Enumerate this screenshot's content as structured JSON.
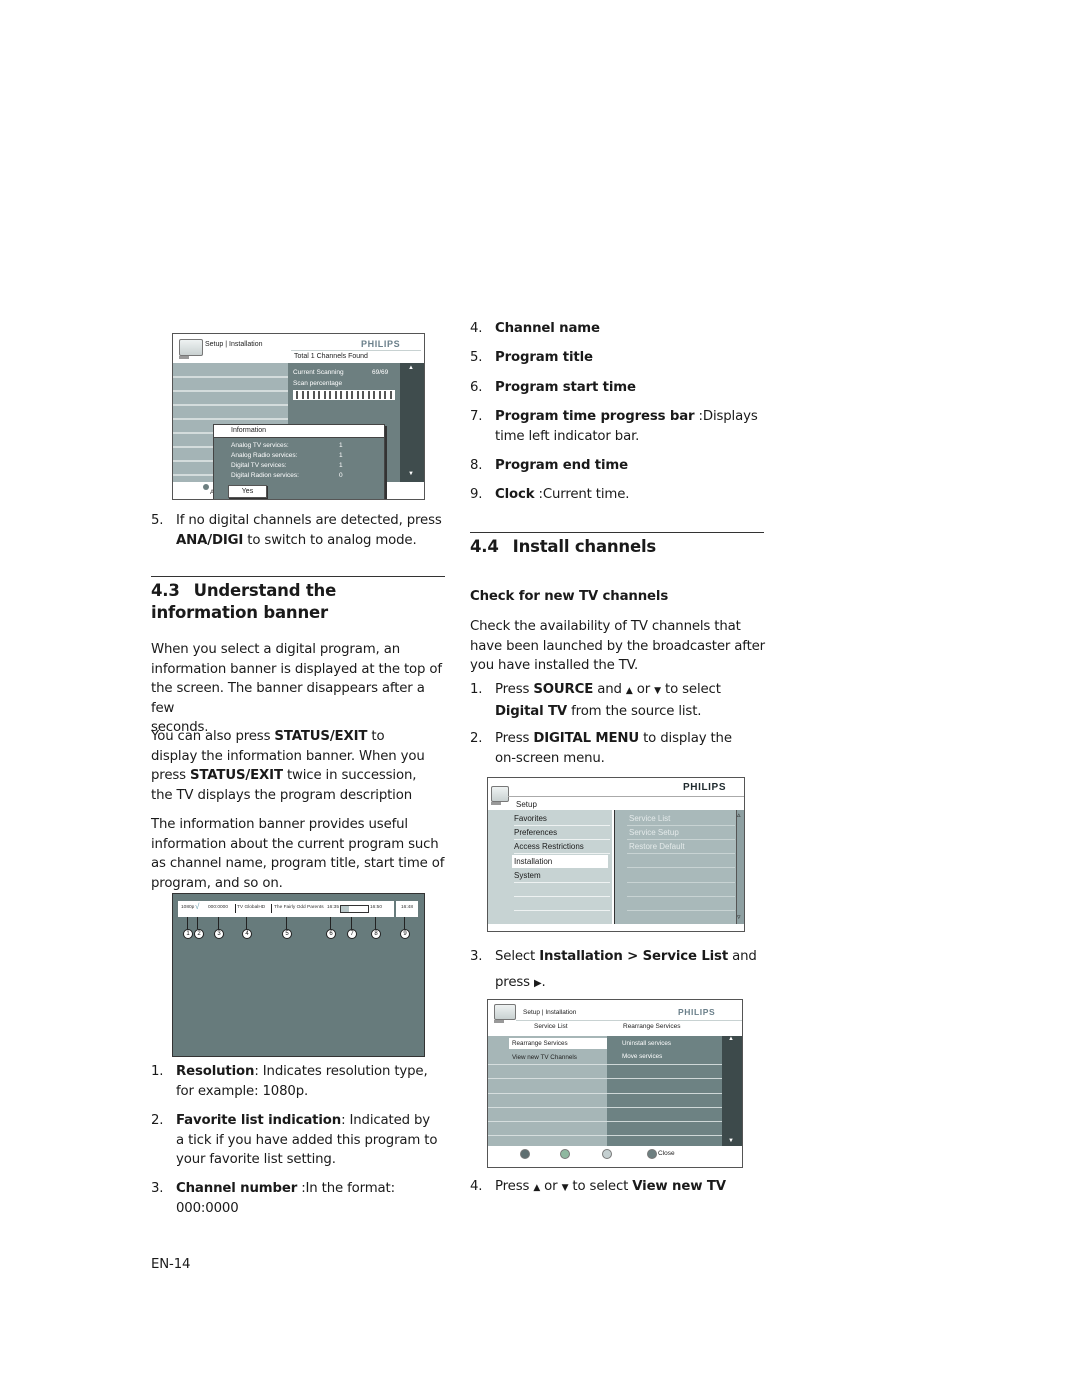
{
  "left_column": {
    "step5": {
      "number": "5.",
      "line1": "If no digital channels are detected, press",
      "bold": "ANA/DIGI",
      "rest": " to switch to analog mode."
    },
    "section_43": {
      "number": "4.3",
      "title_line1": "Understand the",
      "title_line2": "information banner"
    },
    "para1": [
      "When you select a digital program, an",
      "information banner is displayed at the top of",
      "the screen. The banner disappears after a few",
      "seconds."
    ],
    "para2": {
      "l1_pre": "You can also press ",
      "l1_bold": "STATUS/EXIT",
      "l1_post": " to",
      "l2": "display the information banner. When you",
      "l3_pre": "press ",
      "l3_bold": "STATUS/EXIT",
      "l3_post": " twice in succession,",
      "l4": "the TV displays the program description"
    },
    "para3": [
      "The information banner provides useful",
      "information about the current program such",
      "as channel name, program title, start time of",
      "program, and so on."
    ],
    "items": [
      {
        "n": "1.",
        "bold": "Resolution",
        "text": ": Indicates resolution type,",
        "cont": "for example: 1080p."
      },
      {
        "n": "2.",
        "bold": "Favorite list indication",
        "text": ": Indicated by",
        "cont": "a tick if you have added this program to",
        "cont2": "your favorite list setting."
      },
      {
        "n": "3.",
        "bold": "Channel number",
        "text": " :In the format:",
        "cont": "000:0000"
      }
    ],
    "page_number": "EN-14"
  },
  "right_column": {
    "items": [
      {
        "n": "4.",
        "bold": "Channel name"
      },
      {
        "n": "5.",
        "bold": "Program title"
      },
      {
        "n": "6.",
        "bold": "Program start time"
      },
      {
        "n": "7.",
        "bold": "Program time progress bar",
        "text": " :Displays",
        "cont": "time left indicator bar."
      },
      {
        "n": "8.",
        "bold": "Program end time"
      },
      {
        "n": "9.",
        "bold": "Clock",
        "text": " :Current time."
      }
    ],
    "section_44": {
      "number": "4.4",
      "title": "Install channels"
    },
    "subheading": "Check for new TV channels",
    "intro": [
      "Check the availability of TV channels that",
      "have been launched by the broadcaster after",
      "you have installed the TV."
    ],
    "steps": [
      {
        "n": "1.",
        "l1_pre": "Press ",
        "l1_bold": "SOURCE",
        "l1_mid": " and ",
        "up": "▲",
        "or": " or ",
        "down": "▼",
        "l1_post": " to select",
        "l2_bold": "Digital TV",
        "l2_post": " from the source list."
      },
      {
        "n": "2.",
        "l1_pre": "Press ",
        "l1_bold": "DIGITAL MENU",
        "l1_post": " to display the",
        "l2": "on-screen menu."
      },
      {
        "n": "3.",
        "l1_pre": "Select ",
        "l1_bold": "Installation > Service List",
        "l1_post": " and",
        "l2": "press ",
        "arrow": "▶",
        "l2_post": "."
      },
      {
        "n": "4.",
        "l1_pre": "Press ",
        "up": "▲",
        "or": " or ",
        "down": "▼",
        "l1_mid": " to select ",
        "l1_bold": "View new TV"
      }
    ]
  },
  "screen_scan": {
    "breadcrumb_setup": "Setup",
    "breadcrumb_sep": "|",
    "breadcrumb_installation": "Installation",
    "brand": "PHILIPS",
    "total_found": "Total 1 Channels Found",
    "current_scanning_label": "Current Scanning",
    "current_scanning_value": "69/69",
    "scan_percentage_label": "Scan percentage",
    "scan_progress": 1.0,
    "dialog_title": "Information",
    "rows": [
      {
        "label": "Analog TV services:",
        "value": "1"
      },
      {
        "label": "Analog Radio services:",
        "value": "1"
      },
      {
        "label": "Digital TV services:",
        "value": "1"
      },
      {
        "label": "Digital Radion services:",
        "value": "0"
      }
    ],
    "yes_button": "Yes",
    "footer": "A service scan is in progress, please press OK to stop.",
    "scroll_up": "▲",
    "scroll_down": "▼"
  },
  "screen_banner": {
    "resolution": "1080p",
    "tick": "√",
    "channel_number": "000:0000",
    "channel_name": "TV GlobalHD",
    "program_title": "The Fairly Odd Parents",
    "start_time": "16:35",
    "progress": 0.3,
    "end_time": "16:50",
    "clock": "16:48",
    "callouts": [
      "1",
      "2",
      "3",
      "4",
      "5",
      "6",
      "7",
      "8",
      "9"
    ]
  },
  "screen_setup": {
    "brand": "PHILIPS",
    "title": "Setup",
    "menu": [
      "Favorites",
      "Preferences",
      "Access Restrictions",
      "Installation",
      "System"
    ],
    "selected": "Installation",
    "submenu": [
      "Service List",
      "Service Setup",
      "Restore Default"
    ],
    "scroll_up": "▵",
    "scroll_down": "▿"
  },
  "screen_service": {
    "breadcrumb_setup": "Setup",
    "breadcrumb_sep": "|",
    "breadcrumb_installation": "Installation",
    "brand": "PHILIPS",
    "col1_header": "Service List",
    "col2_header": "Rearrange Services",
    "left_items": [
      "Rearrange Services",
      "View new TV Channels"
    ],
    "right_items": [
      "Uninstall services",
      "Move services"
    ],
    "close_label": "Close",
    "button_colors": [
      "#5e6e70",
      "#8fb8a0",
      "#c4cfd0",
      "#6d7f80"
    ],
    "scroll_up": "▲",
    "scroll_down": "▼"
  }
}
